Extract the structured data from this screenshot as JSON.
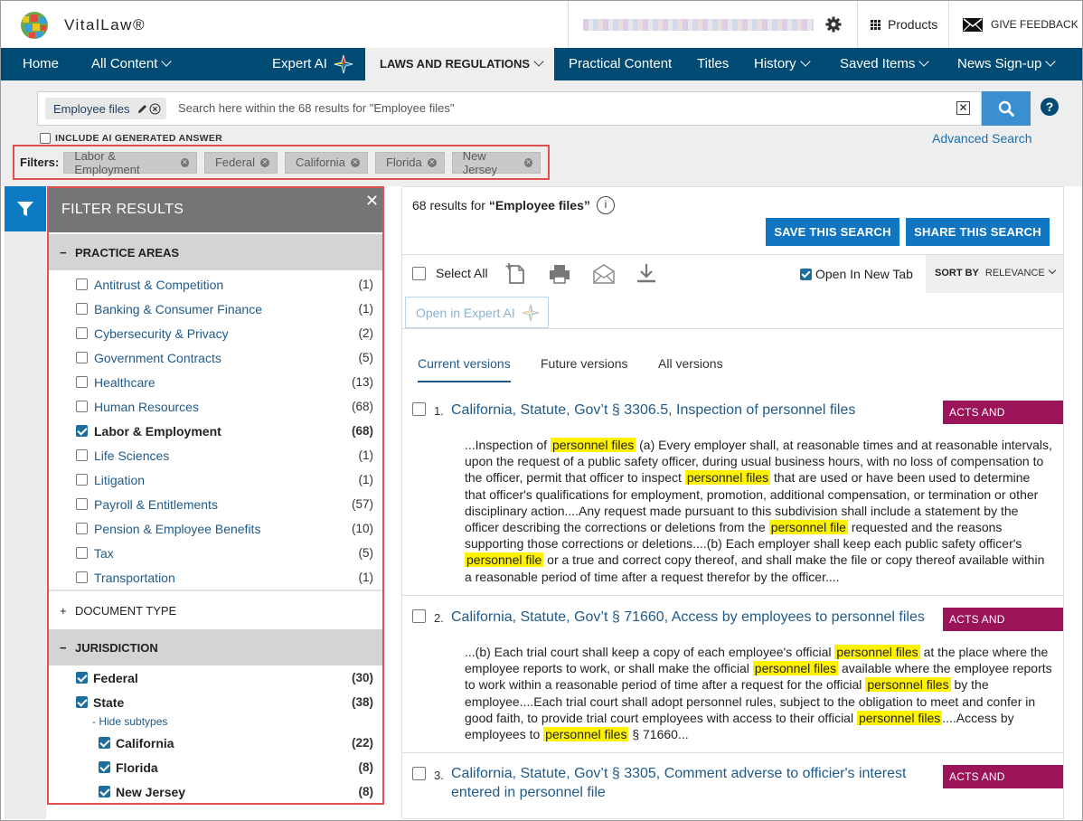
{
  "app": {
    "logo_text": "VitalLaw®",
    "products_label": "Products",
    "feedback_label": "GIVE FEEDBACK"
  },
  "icons": {
    "settings": "gear-icon",
    "products": "grid-icon",
    "feedback": "envelope-icon",
    "search": "search-icon",
    "help": "help-icon",
    "filter": "filter-icon",
    "info": "info-icon"
  },
  "colors": {
    "nav_bg": "#004b73",
    "accent_blue": "#1175c2",
    "badge": "#9b1358",
    "highlight": "#fff200",
    "filter_outline": "#e05050"
  },
  "nav": {
    "home": "Home",
    "all_content": "All Content",
    "expert_ai": "Expert AI",
    "laws": "LAWS AND REGULATIONS",
    "practical": "Practical Content",
    "titles": "Titles",
    "history": "History",
    "saved": "Saved Items",
    "news": "News Sign-up"
  },
  "search": {
    "chip": "Employee files",
    "placeholder": "Search here within the 68 results for \"Employee files\"",
    "clear": "✕",
    "ai_answer": "INCLUDE AI GENERATED ANSWER",
    "advanced": "Advanced Search",
    "help": "?"
  },
  "filters": {
    "label": "Filters:",
    "chips": [
      "Labor & Employment",
      "Federal",
      "California",
      "Florida",
      "New Jersey"
    ]
  },
  "panel": {
    "title": "FILTER RESULTS",
    "close": "✕",
    "practice_areas": "PRACTICE AREAS",
    "doc_type": "DOCUMENT TYPE",
    "jurisdiction": "JURISDICTION",
    "hide_subtypes": "- Hide subtypes",
    "areas": [
      {
        "label": "Antitrust & Competition",
        "count": "(1)",
        "checked": false
      },
      {
        "label": "Banking & Consumer Finance",
        "count": "(1)",
        "checked": false
      },
      {
        "label": "Cybersecurity & Privacy",
        "count": "(2)",
        "checked": false
      },
      {
        "label": "Government Contracts",
        "count": "(5)",
        "checked": false
      },
      {
        "label": "Healthcare",
        "count": "(13)",
        "checked": false
      },
      {
        "label": "Human Resources",
        "count": "(68)",
        "checked": false
      },
      {
        "label": "Labor & Employment",
        "count": "(68)",
        "checked": true
      },
      {
        "label": "Life Sciences",
        "count": "(1)",
        "checked": false
      },
      {
        "label": "Litigation",
        "count": "(1)",
        "checked": false
      },
      {
        "label": "Payroll & Entitlements",
        "count": "(57)",
        "checked": false
      },
      {
        "label": "Pension & Employee Benefits",
        "count": "(10)",
        "checked": false
      },
      {
        "label": "Tax",
        "count": "(5)",
        "checked": false
      },
      {
        "label": "Transportation",
        "count": "(1)",
        "checked": false
      }
    ],
    "jurisdictions": [
      {
        "label": "Federal",
        "count": "(30)",
        "checked": true
      },
      {
        "label": "State",
        "count": "(38)",
        "checked": true
      },
      {
        "label": "California",
        "count": "(22)",
        "checked": true
      },
      {
        "label": "Florida",
        "count": "(8)",
        "checked": true
      },
      {
        "label": "New Jersey",
        "count": "(8)",
        "checked": true
      }
    ]
  },
  "results": {
    "count_prefix": "68 results for ",
    "count_query": "“Employee files”",
    "save": "SAVE THIS SEARCH",
    "share": "SHARE THIS SEARCH",
    "select_all": "Select All",
    "open_new_tab": "Open In New Tab",
    "sort_by": "SORT BY",
    "sort_value": "RELEVANCE",
    "open_expert": "Open in Expert AI",
    "tabs": [
      "Current versions",
      "Future versions",
      "All versions"
    ],
    "items": [
      {
        "num": "1.",
        "title": "California, Statute, Gov’t § 3306.5, Inspection of personnel files",
        "badge": "ACTS AND STATUTES",
        "snippet_parts": [
          "...Inspection of ",
          "personnel files",
          " (a) Every employer shall, at reasonable times and at reasonable intervals, upon the request of a public safety officer, during usual business hours, with no loss of compensation to the officer, permit that officer to inspect ",
          "personnel files",
          " that are used or have been used to determine that officer's qualifications for employment, promotion, additional compensation, or termination or other disciplinary action....Any request made pursuant to this subdivision shall include a statement by the officer describing the corrections or deletions from the ",
          "personnel file",
          " requested and the reasons supporting those corrections or deletions....(b) Each employer shall keep each public safety officer's ",
          "personnel file",
          " or a true and correct copy thereof, and shall make the file or copy thereof available within a reasonable period of time after a request therefor by the officer...."
        ]
      },
      {
        "num": "2.",
        "title": "California, Statute, Gov’t § 71660, Access by employees to personnel files",
        "badge": "ACTS AND STATUTES",
        "snippet_parts": [
          "...(b) Each trial court shall keep a copy of each employee's official ",
          "personnel files",
          " at the place where the employee reports to work, or shall make the official ",
          "personnel files",
          " available where the employee reports to work within a reasonable period of time after a request for the official ",
          "personnel files",
          " by the employee....Each trial court shall adopt personnel rules, subject to the obligation to meet and confer in good faith, to provide trial court employees with access to their official ",
          "personnel files",
          "....Access by employees to ",
          "personnel files",
          " § 71660..."
        ]
      },
      {
        "num": "3.",
        "title": "California, Statute, Gov’t § 3305, Comment adverse to officier's interest entered in personnel file",
        "badge": "ACTS AND STATUTES",
        "snippet_parts": []
      }
    ]
  }
}
